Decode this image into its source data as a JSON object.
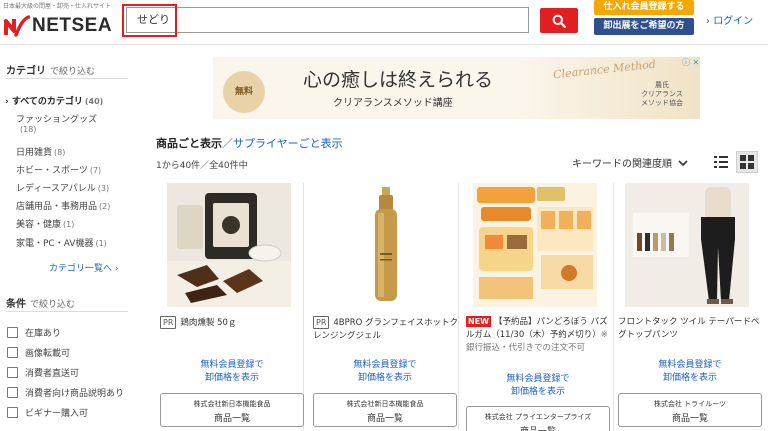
{
  "header": {
    "tagline": "日本最大級の問屋・卸売・仕入れサイト",
    "logo_text": "NETSEA",
    "search_value": "せどり",
    "register_button": "仕入れ会員登録する",
    "exhibit_button": "卸出展をご希望の方",
    "login": "ログイン"
  },
  "sidebar": {
    "category_heading": "カテゴリ",
    "category_sub": "で絞り込む",
    "all_categories": {
      "label": "すべてのカテゴリ",
      "count": "(40)"
    },
    "categories": [
      {
        "label": "ファッショングッズ",
        "count": "(18)"
      },
      {
        "label": "日用雑貨",
        "count": "(8)"
      },
      {
        "label": "ホビー・スポーツ",
        "count": "(7)"
      },
      {
        "label": "レディースアパレル",
        "count": "(3)"
      },
      {
        "label": "店舗用品・事務用品",
        "count": "(2)"
      },
      {
        "label": "美容・健康",
        "count": "(1)"
      },
      {
        "label": "家電・PC・AV機器",
        "count": "(1)"
      }
    ],
    "category_more": "カテゴリ一覧へ",
    "condition_heading": "条件",
    "condition_sub": "で絞り込む",
    "conditions": [
      "在庫あり",
      "画像転載可",
      "消費者直送可",
      "消費者向け商品説明あり",
      "ビギナー購入可"
    ]
  },
  "banner": {
    "free_badge": "無料",
    "title": "心の癒しは終えられる",
    "subtitle": "クリアランスメソッド講座",
    "script_text": "Clearance Method",
    "org_line1": "農氏",
    "org_line2": "クリアランス",
    "org_line3": "メソッド協会",
    "ad_label": "ⓘ ✕"
  },
  "results": {
    "tab_products": "商品ごと表示",
    "tab_separator": "／",
    "tab_suppliers": "サプライヤーごと表示",
    "count_text": "1から40件／全40件中",
    "sort_label": "キーワードの関連度順"
  },
  "products": [
    {
      "badge": "PR",
      "badge_type": "pr",
      "name": "鶏肉燻製 50ｇ",
      "note": "",
      "price_line1": "無料会員登録で",
      "price_line2": "卸価格を表示",
      "seller": "株式会社新日本機能食品",
      "seller_link": "商品一覧"
    },
    {
      "badge": "PR",
      "badge_type": "pr",
      "name": "4BPRO グランフェイスホットクレンジングジェル",
      "note": "",
      "price_line1": "無料会員登録で",
      "price_line2": "卸価格を表示",
      "seller": "株式会社新日本機能食品",
      "seller_link": "商品一覧"
    },
    {
      "badge": "NEW",
      "badge_type": "new",
      "name": "【予約品】パンどろぼう パズルガム（11/30（木）予約〆切り）",
      "note": "※銀行振込・代引きでの注文不可",
      "price_line1": "無料会員登録で",
      "price_line2": "卸価格を表示",
      "seller": "株式会社 プライエンタープライズ",
      "seller_link": "商品一覧"
    },
    {
      "badge": "",
      "badge_type": "",
      "name": "フロントタック ツイル テーパードペグトップパンツ",
      "note": "",
      "price_line1": "無料会員登録で",
      "price_line2": "卸価格を表示",
      "seller": "株式会社 トライルーツ",
      "seller_link": "商品一覧"
    }
  ],
  "colors": {
    "accent": "#e02020",
    "link": "#1f62c4",
    "register": "#f3a700",
    "exhibit": "#2f4f8f"
  }
}
